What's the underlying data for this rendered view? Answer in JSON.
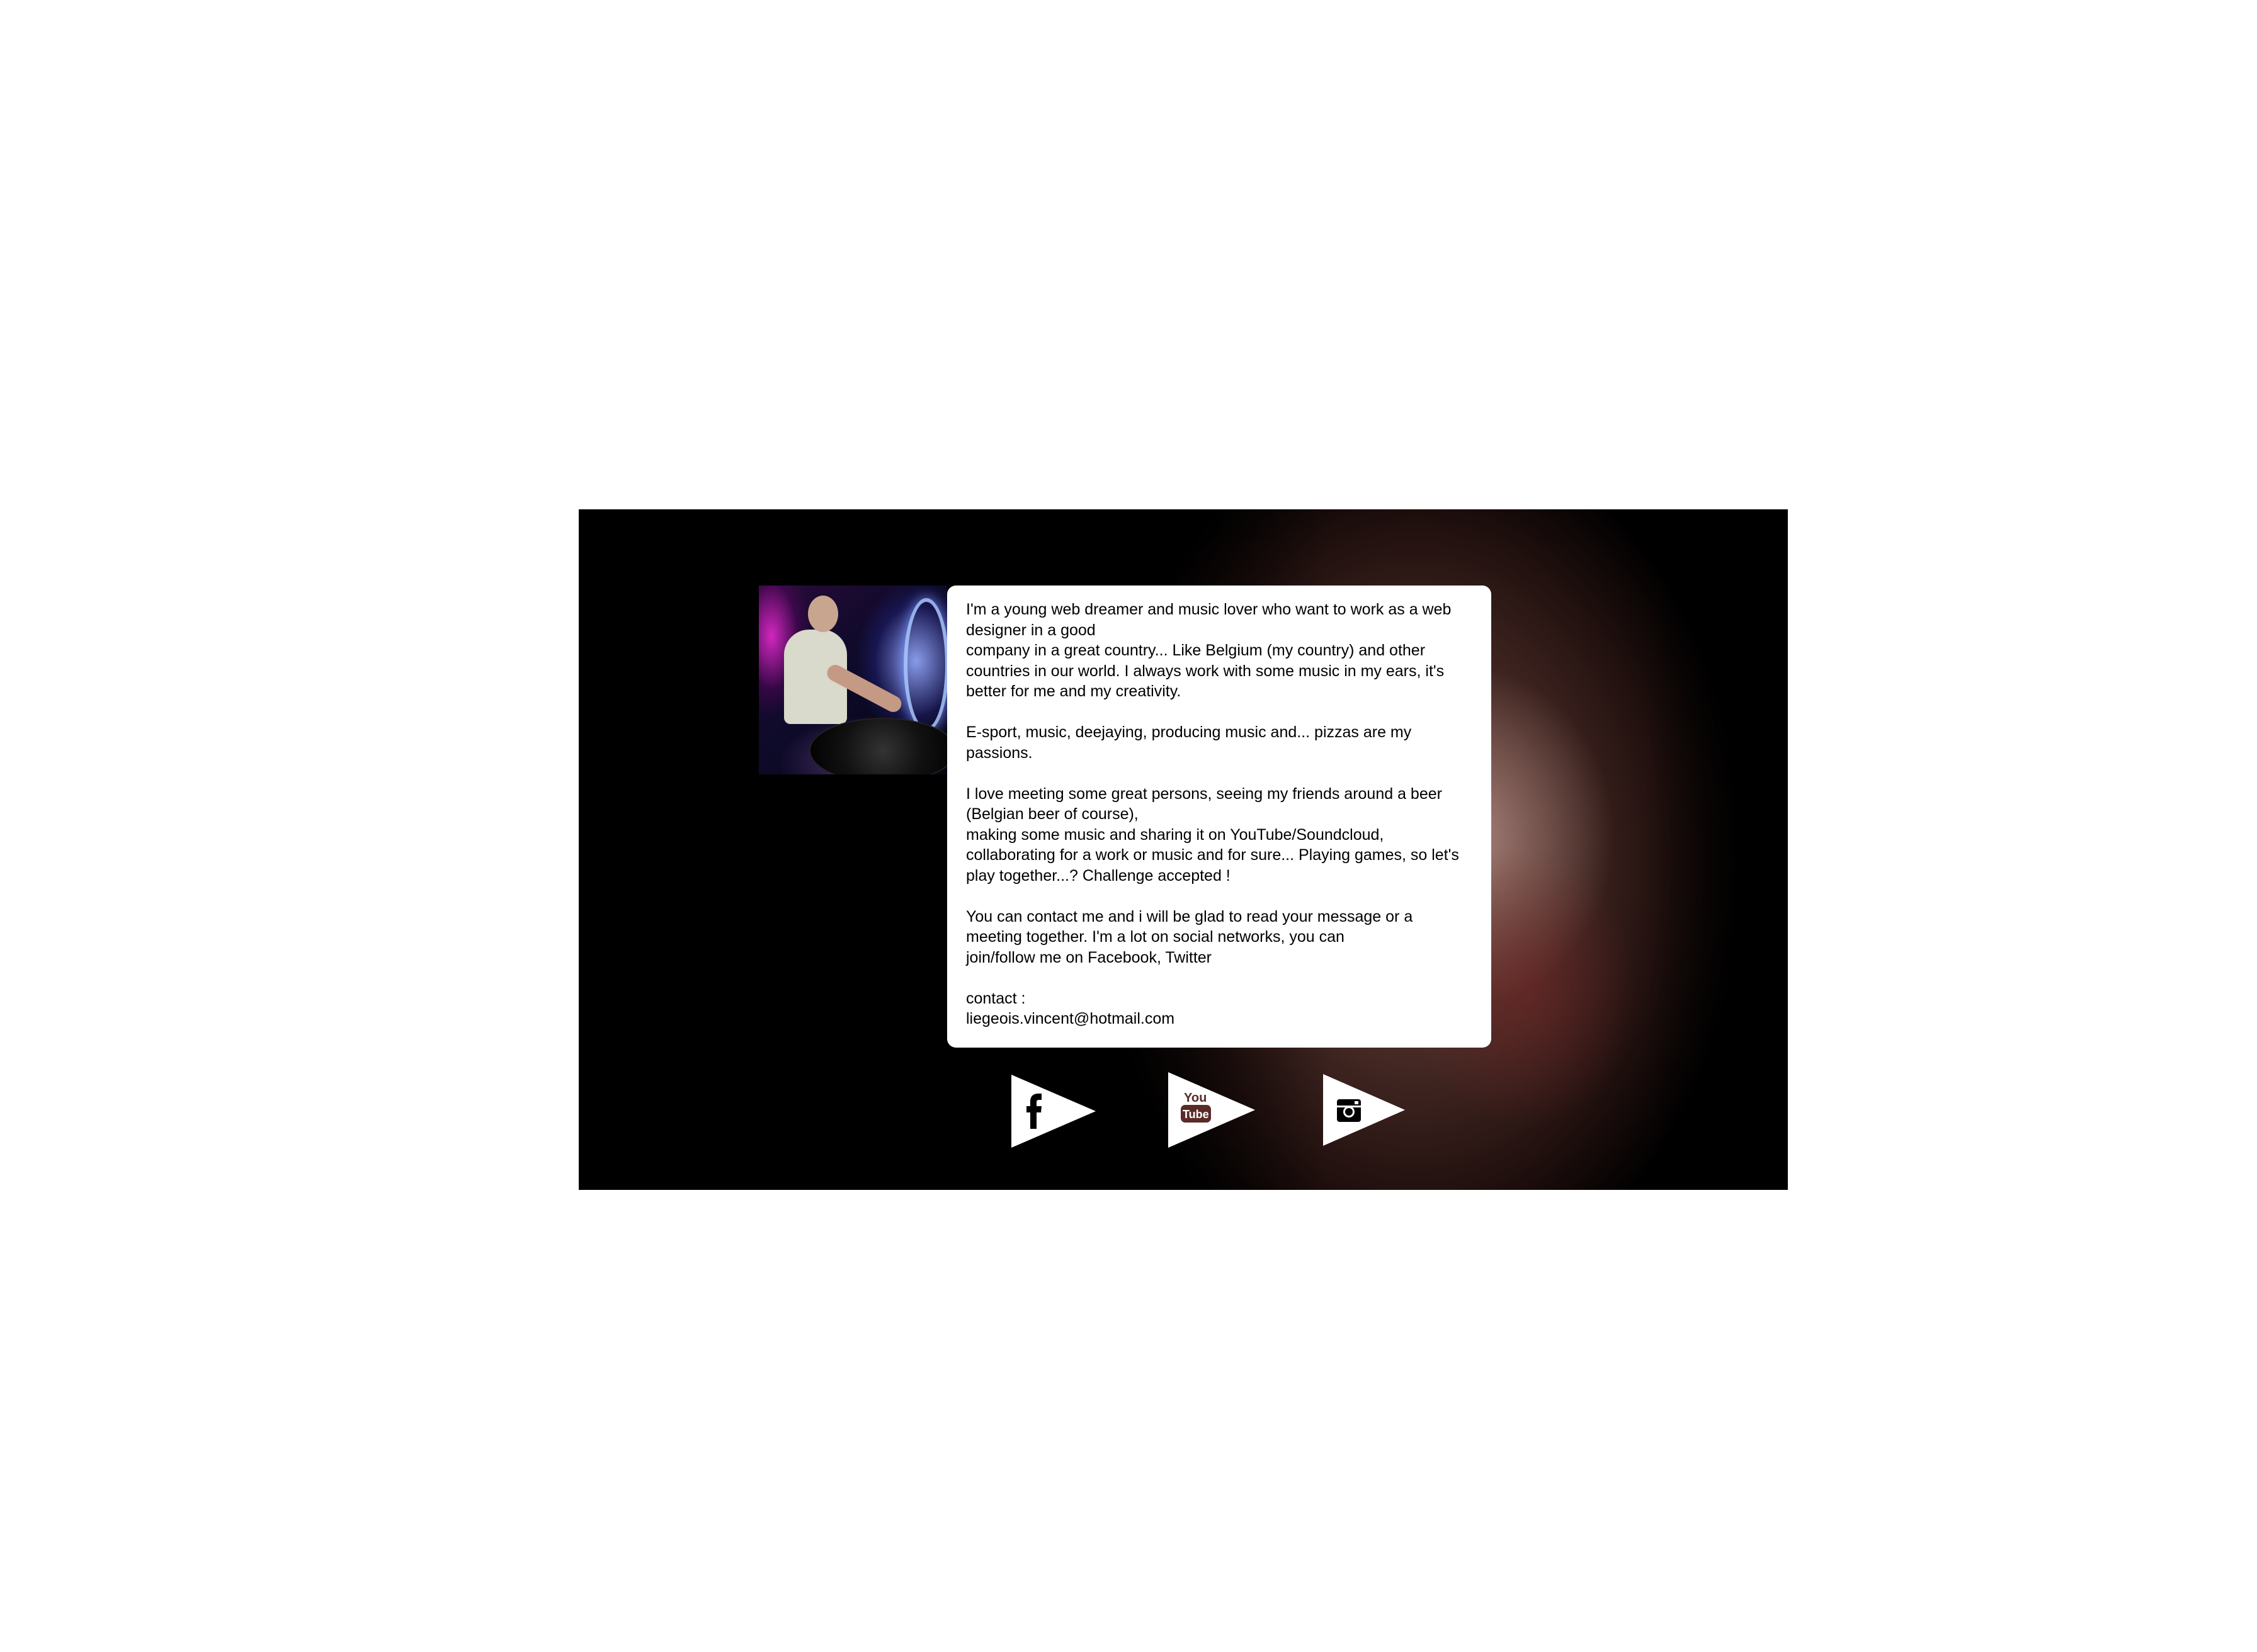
{
  "bio": {
    "paragraphs": [
      "I'm a young web dreamer and music lover who want to work as a web designer in a good\ncompany in a great country... Like Belgium (my country) and other countries in our world. I always work with some music in my ears, it's better for me and my creativity.",
      "E-sport, music, deejaying, producing music and... pizzas are my passions.",
      "I love meeting some great persons, seeing my friends around a beer (Belgian beer of course),\nmaking some music and sharing it on YouTube/Soundcloud, collaborating for a work or music and for sure... Playing games, so let's play together...? Challenge accepted !",
      "You can contact me and i will be glad to read your message or a meeting together. I'm a lot on social networks, you can\njoin/follow me on Facebook, Twitter"
    ],
    "contact_label": "contact :",
    "contact_email": "liegeois.vincent@hotmail.com"
  },
  "social": {
    "links": [
      {
        "name": "facebook",
        "icon": "facebook-icon"
      },
      {
        "name": "youtube",
        "icon": "youtube-icon",
        "icon_text_top": "You",
        "icon_text_bottom": "Tube"
      },
      {
        "name": "instagram",
        "icon": "instagram-icon"
      }
    ]
  },
  "colors": {
    "card_background": "#ffffff",
    "page_background": "#000000",
    "youtube_icon": "#5a2b27",
    "icon_dark": "#000000"
  }
}
